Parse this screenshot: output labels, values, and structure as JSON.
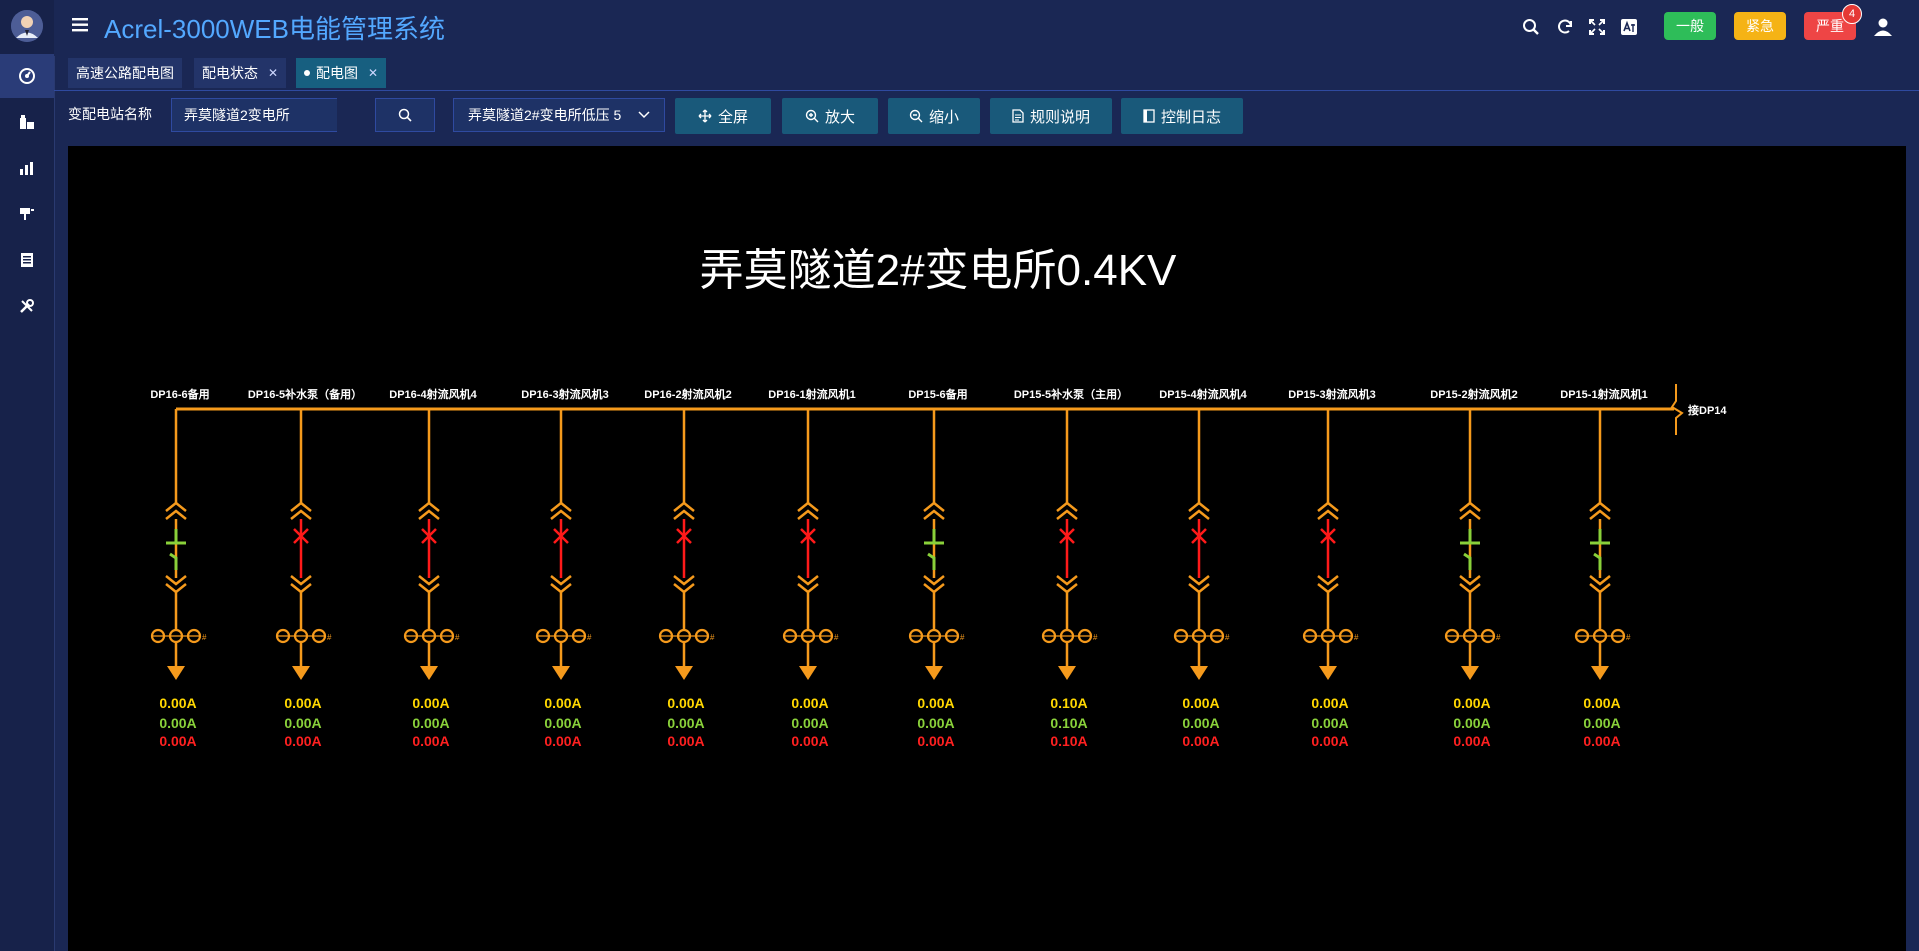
{
  "app": {
    "title": "Acrel-3000WEB电能管理系统"
  },
  "sidebar": {
    "items": [
      {
        "icon": "dashboard-icon",
        "active": true
      },
      {
        "icon": "building-icon",
        "active": false
      },
      {
        "icon": "bar-chart-icon",
        "active": false
      },
      {
        "icon": "device-icon",
        "active": false
      },
      {
        "icon": "report-icon",
        "active": false
      },
      {
        "icon": "tools-icon",
        "active": false
      }
    ]
  },
  "header": {
    "icons": [
      "search-icon",
      "refresh-icon",
      "fullscreen-icon",
      "translate-icon"
    ],
    "alarm_buttons": [
      {
        "label": "一般",
        "color": "#2ebd59"
      },
      {
        "label": "紧急",
        "color": "#f5b315"
      },
      {
        "label": "严重",
        "color": "#ee4545",
        "count": "4"
      }
    ]
  },
  "tabs": [
    {
      "label": "高速公路配电图",
      "closable": false,
      "active": false
    },
    {
      "label": "配电状态",
      "closable": true,
      "active": false
    },
    {
      "label": "配电图",
      "closable": true,
      "active": true
    }
  ],
  "toolbar": {
    "station_label": "变配电站名称",
    "station_value": "弄莫隧道2变电所",
    "select_value": "弄莫隧道2#变电所低压 5",
    "buttons": [
      {
        "label": "全屏",
        "icon": "move-icon"
      },
      {
        "label": "放大",
        "icon": "zoom-in-icon"
      },
      {
        "label": "缩小",
        "icon": "zoom-out-icon"
      },
      {
        "label": "规则说明",
        "icon": "document-icon"
      },
      {
        "label": "控制日志",
        "icon": "log-icon"
      }
    ]
  },
  "diagram": {
    "title": "弄莫隧道2#变电所0.4KV",
    "bus_end_label": "接DP14",
    "colors": {
      "bus": "#f59a1c",
      "closed": "#8ad13a",
      "open": "#ff1a1a",
      "current_a": "#ffd800",
      "current_b": "#8ad13a",
      "current_c": "#ff2020"
    },
    "feeders": [
      {
        "label": "DP16-6备用",
        "state": "closed",
        "currents": [
          "0.00A",
          "0.00A",
          "0.00A"
        ]
      },
      {
        "label": "DP16-5补水泵（备用）",
        "state": "open",
        "currents": [
          "0.00A",
          "0.00A",
          "0.00A"
        ]
      },
      {
        "label": "DP16-4射流风机4",
        "state": "open",
        "currents": [
          "0.00A",
          "0.00A",
          "0.00A"
        ]
      },
      {
        "label": "DP16-3射流风机3",
        "state": "open",
        "currents": [
          "0.00A",
          "0.00A",
          "0.00A"
        ]
      },
      {
        "label": "DP16-2射流风机2",
        "state": "open",
        "currents": [
          "0.00A",
          "0.00A",
          "0.00A"
        ]
      },
      {
        "label": "DP16-1射流风机1",
        "state": "open",
        "currents": [
          "0.00A",
          "0.00A",
          "0.00A"
        ]
      },
      {
        "label": "DP15-6备用",
        "state": "closed",
        "currents": [
          "0.00A",
          "0.00A",
          "0.00A"
        ]
      },
      {
        "label": "DP15-5补水泵（主用）",
        "state": "open",
        "currents": [
          "0.10A",
          "0.10A",
          "0.10A"
        ]
      },
      {
        "label": "DP15-4射流风机4",
        "state": "open",
        "currents": [
          "0.00A",
          "0.00A",
          "0.00A"
        ]
      },
      {
        "label": "DP15-3射流风机3",
        "state": "open",
        "currents": [
          "0.00A",
          "0.00A",
          "0.00A"
        ]
      },
      {
        "label": "DP15-2射流风机2",
        "state": "closed",
        "currents": [
          "0.00A",
          "0.00A",
          "0.00A"
        ]
      },
      {
        "label": "DP15-1射流风机1",
        "state": "closed",
        "currents": [
          "0.00A",
          "0.00A",
          "0.00A"
        ]
      }
    ]
  }
}
